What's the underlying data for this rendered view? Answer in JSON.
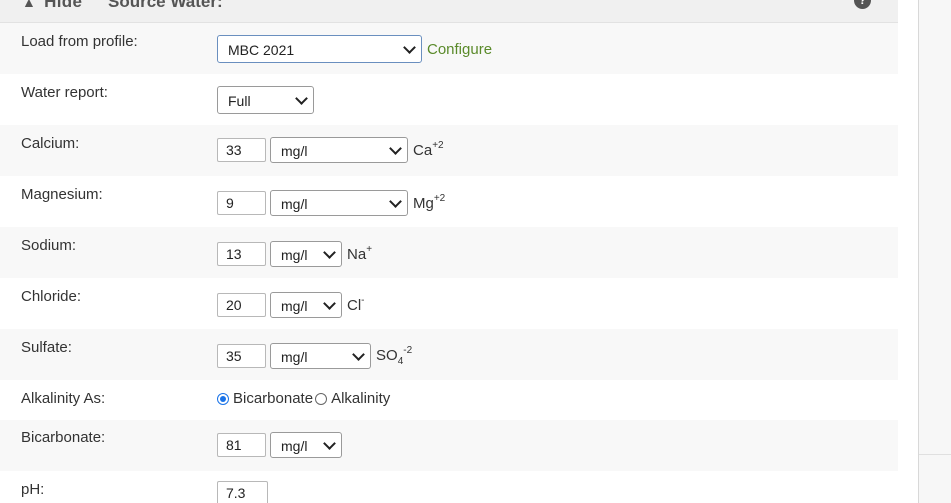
{
  "header": {
    "toggle_label": "Hide",
    "title": "Source Water:",
    "help_icon": "?"
  },
  "rows": {
    "profile": {
      "label": "Load from profile:",
      "value": "MBC 2021",
      "link": "Configure"
    },
    "report": {
      "label": "Water report:",
      "value": "Full"
    },
    "calcium": {
      "label": "Calcium:",
      "value": "33",
      "unit": "mg/l",
      "ion": "Ca",
      "charge": "+2"
    },
    "magnesium": {
      "label": "Magnesium:",
      "value": "9",
      "unit": "mg/l",
      "ion": "Mg",
      "charge": "+2"
    },
    "sodium": {
      "label": "Sodium:",
      "value": "13",
      "unit": "mg/l",
      "ion": "Na",
      "charge": "+"
    },
    "chloride": {
      "label": "Chloride:",
      "value": "20",
      "unit": "mg/l",
      "ion": "Cl",
      "charge": "-"
    },
    "sulfate": {
      "label": "Sulfate:",
      "value": "35",
      "unit": "mg/l",
      "ion": "SO",
      "subscript": "4",
      "charge": "-2"
    },
    "alkalinity": {
      "label": "Alkalinity As:",
      "options": [
        "Bicarbonate",
        "Alkalinity"
      ],
      "selected": "Bicarbonate"
    },
    "bicarbonate": {
      "label": "Bicarbonate:",
      "value": "81",
      "unit": "mg/l"
    },
    "ph": {
      "label": "pH:",
      "value": "7.3"
    }
  },
  "colors": {
    "link": "#5a8a2a",
    "radio_selected": "#1a73e8",
    "row_alt": "#f8f8f8"
  }
}
